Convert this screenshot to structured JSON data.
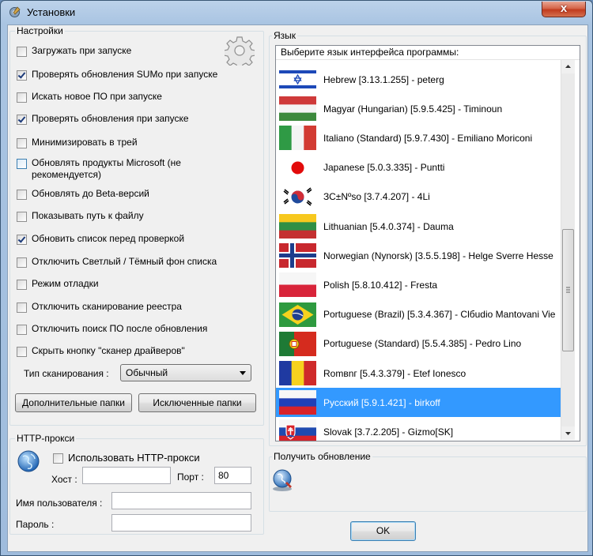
{
  "window": {
    "title": "Установки",
    "close_glyph": "x"
  },
  "settings": {
    "group_title": "Настройки",
    "checkboxes": [
      {
        "label": "Загружать при запуске",
        "checked": false
      },
      {
        "label": "Проверять обновления SUMo при запуске",
        "checked": true
      },
      {
        "label": "Искать новое ПО при запуске",
        "checked": false
      },
      {
        "label": "Проверять обновления при запуске",
        "checked": true
      },
      {
        "label": "Минимизировать в трей",
        "checked": false
      },
      {
        "label": "Обновлять продукты Microsoft (не рекомендуется)",
        "checked": false
      },
      {
        "label": "Обновлять до Beta-версий",
        "checked": false
      },
      {
        "label": "Показывать путь к файлу",
        "checked": false
      },
      {
        "label": "Обновить список перед проверкой",
        "checked": true
      },
      {
        "label": "Отключить Светлый / Тёмный фон списка",
        "checked": false
      },
      {
        "label": "Режим отладки",
        "checked": false
      },
      {
        "label": "Отключить сканирование реестра",
        "checked": false
      },
      {
        "label": "Отключить поиск ПО после обновления",
        "checked": false
      },
      {
        "label": "Скрыть кнопку \"сканер драйверов\"",
        "checked": false
      }
    ],
    "scan_type_label": "Тип сканирования :",
    "scan_type_value": "Обычный",
    "extra_folders_button": "Дополнительные папки",
    "excluded_folders_button": "Исключенные папки"
  },
  "proxy": {
    "group_title": "HTTP-прокси",
    "use_proxy_label": "Использовать HTTP-прокси",
    "use_proxy_checked": false,
    "host_label": "Хост :",
    "host_value": "",
    "port_label": "Порт :",
    "port_value": "80",
    "username_label": "Имя пользователя :",
    "username_value": "",
    "password_label": "Пароль :",
    "password_value": ""
  },
  "language": {
    "group_title": "Язык",
    "list_header": "Выберите язык интерфейса программы:",
    "items": [
      {
        "name": "Hebrew [3.13.1.255] - peterg",
        "flag": "hebrew-flag-icon"
      },
      {
        "name": "Magyar (Hungarian) [5.9.5.425] - Timinoun",
        "flag": "hungarian-flag-icon"
      },
      {
        "name": "Italiano (Standard) [5.9.7.430] - Emiliano Moriconi",
        "flag": "italian-flag-icon"
      },
      {
        "name": "Japanese [5.0.3.335] - Puntti",
        "flag": "japanese-flag-icon"
      },
      {
        "name": "ЗС±Nºso [3.7.4.207] - 4Li",
        "flag": "korean-flag-icon"
      },
      {
        "name": "Lithuanian [5.4.0.374] - Dauma",
        "flag": "lithuanian-flag-icon"
      },
      {
        "name": "Norwegian (Nynorsk) [3.5.5.198] - Helge Sverre Hesse",
        "flag": "norwegian-flag-icon"
      },
      {
        "name": "Polish [5.8.10.412] - Fresta",
        "flag": "polish-flag-icon"
      },
      {
        "name": "Portuguese (Brazil) [5.3.4.367] - Clбudio Mantovani Vie",
        "flag": "brazil-flag-icon"
      },
      {
        "name": "Portuguese (Standard) [5.5.4.385] - Pedro Lino",
        "flag": "portugal-flag-icon"
      },
      {
        "name": "Romвnг [5.4.3.379] - Etef Ionesco",
        "flag": "romanian-flag-icon"
      },
      {
        "name": "Русский [5.9.1.421] - birkoff",
        "flag": "russian-flag-icon"
      },
      {
        "name": "Slovak [3.7.2.205] - Gizmo[SK]",
        "flag": "slovak-flag-icon"
      }
    ],
    "selected_index": 11
  },
  "update": {
    "group_title": "Получить обновление"
  },
  "ok_button": "OK",
  "colors": {
    "selection": "#3399ff",
    "title_bar": "#a9c4e2",
    "close_button": "#c13b1e"
  }
}
